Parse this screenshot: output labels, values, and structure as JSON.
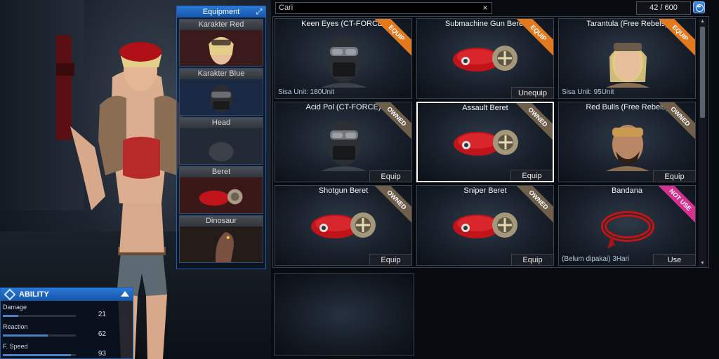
{
  "equipment": {
    "title": "Equipment",
    "slots": [
      {
        "label": "Karakter Red"
      },
      {
        "label": "Karakter Blue"
      },
      {
        "label": "Head"
      },
      {
        "label": "Beret"
      },
      {
        "label": "Dinosaur"
      }
    ]
  },
  "ability": {
    "title": "ABILITY",
    "stats": [
      {
        "name": "Damage",
        "value": "21",
        "level": 0.21
      },
      {
        "name": "Reaction",
        "value": "62",
        "level": 0.62
      },
      {
        "name": "F. Speed",
        "value": "93",
        "level": 0.93
      }
    ]
  },
  "search": {
    "value": "Cari",
    "clear_icon": "×"
  },
  "inventory": {
    "count": "42 / 600",
    "add_icon": "+",
    "items": [
      {
        "title": "Keen Eyes (CT-FORCE)",
        "ribbon": "EQUIP",
        "note": "Sisa Unit: 180Unit",
        "button": "",
        "art": "soldier-mask"
      },
      {
        "title": "Submachine Gun Beret",
        "ribbon": "EQUIP",
        "note": "",
        "button": "Unequip",
        "art": "beret"
      },
      {
        "title": "Tarantula (Free Rebels)",
        "ribbon": "EQUIP",
        "note": "Sisa Unit: 95Unit",
        "button": "",
        "art": "female-portrait"
      },
      {
        "title": "Acid Pol (CT-FORCE)",
        "ribbon": "OWNED",
        "note": "",
        "button": "Equip",
        "art": "soldier-mask"
      },
      {
        "title": "Assault Beret",
        "ribbon": "OWNED",
        "note": "",
        "button": "Equip",
        "art": "beret"
      },
      {
        "title": "Red Bulls (Free Rebels)",
        "ribbon": "OWNED",
        "note": "",
        "button": "Equip",
        "art": "male-portrait"
      },
      {
        "title": "Shotgun Beret",
        "ribbon": "OWNED",
        "note": "",
        "button": "Equip",
        "art": "beret"
      },
      {
        "title": "Sniper Beret",
        "ribbon": "OWNED",
        "note": "",
        "button": "Equip",
        "art": "beret"
      },
      {
        "title": "Bandana",
        "ribbon": "NOT USE",
        "note": "(Belum dipakai) 3Hari",
        "button": "Use",
        "art": "bandana"
      }
    ]
  },
  "scrollbar": {
    "up_icon": "▲",
    "down_icon": "▼"
  },
  "colors": {
    "accent": "#1d6ad0",
    "equip_ribbon": "#e2791c",
    "owned_ribbon": "#6e5e4a",
    "notuse_ribbon": "#d6318f",
    "beret_red": "#c0141a"
  }
}
